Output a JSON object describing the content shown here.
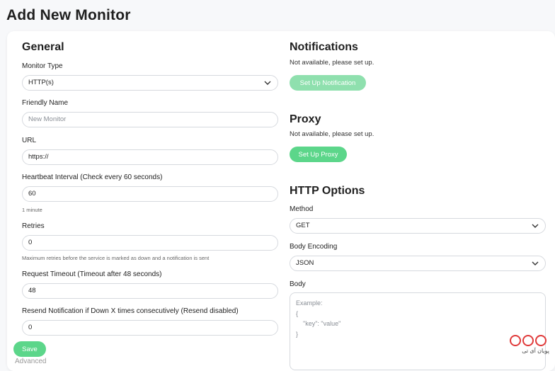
{
  "page": {
    "title": "Add New Monitor"
  },
  "general": {
    "title": "General",
    "monitor_type": {
      "label": "Monitor Type",
      "value": "HTTP(s)"
    },
    "friendly_name": {
      "label": "Friendly Name",
      "placeholder": "New Monitor"
    },
    "url": {
      "label": "URL",
      "value": "https://"
    },
    "heartbeat": {
      "label": "Heartbeat Interval (Check every 60 seconds)",
      "value": "60",
      "help": "1 minute"
    },
    "retries": {
      "label": "Retries",
      "value": "0",
      "help": "Maximum retries before the service is marked as down and a notification is sent"
    },
    "timeout": {
      "label": "Request Timeout (Timeout after 48 seconds)",
      "value": "48"
    },
    "resend": {
      "label": "Resend Notification if Down X times consecutively (Resend disabled)",
      "value": "0"
    },
    "save_label": "Save",
    "advanced_label": "Advanced"
  },
  "notifications": {
    "title": "Notifications",
    "note": "Not available, please set up.",
    "button_label": "Set Up Notification"
  },
  "proxy": {
    "title": "Proxy",
    "note": "Not available, please set up.",
    "button_label": "Set Up Proxy"
  },
  "http_options": {
    "title": "HTTP Options",
    "method": {
      "label": "Method",
      "value": "GET"
    },
    "body_encoding": {
      "label": "Body Encoding",
      "value": "JSON"
    },
    "body": {
      "label": "Body",
      "placeholder": "Example:\n{\n    \"key\": \"value\"\n}"
    }
  },
  "watermark": {
    "text": "پویان آی تی"
  },
  "colors": {
    "accent": "#5cd68a",
    "accent_disabled": "#8fe0ae",
    "watermark": "#e03a3a"
  }
}
